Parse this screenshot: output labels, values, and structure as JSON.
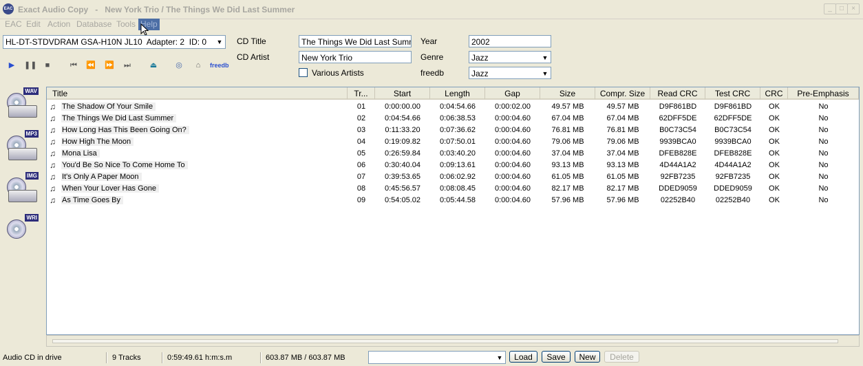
{
  "window": {
    "app_name": "Exact Audio Copy",
    "separator": "-",
    "document_title": "New York Trio / The Things We Did Last Summer",
    "app_icon_text": "EAC"
  },
  "menu": [
    "EAC",
    "Edit",
    "Action",
    "Database",
    "Tools",
    "Help"
  ],
  "drive": {
    "selected": "HL-DT-STDVDRAM GSA-H10N JL10  Adapter: 2  ID: 0"
  },
  "cd": {
    "title_label": "CD Title",
    "title_value": "The Things We Did Last Summer",
    "artist_label": "CD Artist",
    "artist_value": "New York Trio",
    "various_artists_label": "Various Artists",
    "various_artists_checked": false,
    "year_label": "Year",
    "year_value": "2002",
    "genre_label": "Genre",
    "genre_value": "Jazz",
    "freedb_label": "freedb",
    "freedb_value": "Jazz"
  },
  "toolbar": {
    "freedb_button": "freedb"
  },
  "side_buttons": [
    {
      "tag": "WAV",
      "name": "copy-wav-icon"
    },
    {
      "tag": "MP3",
      "name": "copy-mp3-icon"
    },
    {
      "tag": "IMG",
      "name": "copy-image-icon"
    },
    {
      "tag": "WRI",
      "name": "write-cd-icon"
    }
  ],
  "table": {
    "headers": [
      "Title",
      "Tr...",
      "Start",
      "Length",
      "Gap",
      "Size",
      "Compr. Size",
      "Read CRC",
      "Test CRC",
      "CRC",
      "Pre-Emphasis"
    ],
    "rows": [
      [
        "The Shadow Of Your Smile",
        "01",
        "0:00:00.00",
        "0:04:54.66",
        "0:00:02.00",
        "49.57 MB",
        "49.57 MB",
        "D9F861BD",
        "D9F861BD",
        "OK",
        "No"
      ],
      [
        "The Things We Did Last Summer",
        "02",
        "0:04:54.66",
        "0:06:38.53",
        "0:00:04.60",
        "67.04 MB",
        "67.04 MB",
        "62DFF5DE",
        "62DFF5DE",
        "OK",
        "No"
      ],
      [
        "How Long Has This Been Going On?",
        "03",
        "0:11:33.20",
        "0:07:36.62",
        "0:00:04.60",
        "76.81 MB",
        "76.81 MB",
        "B0C73C54",
        "B0C73C54",
        "OK",
        "No"
      ],
      [
        "How High The Moon",
        "04",
        "0:19:09.82",
        "0:07:50.01",
        "0:00:04.60",
        "79.06 MB",
        "79.06 MB",
        "9939BCA0",
        "9939BCA0",
        "OK",
        "No"
      ],
      [
        "Mona Lisa",
        "05",
        "0:26:59.84",
        "0:03:40.20",
        "0:00:04.60",
        "37.04 MB",
        "37.04 MB",
        "DFEB828E",
        "DFEB828E",
        "OK",
        "No"
      ],
      [
        "You'd Be So Nice To Come Home To",
        "06",
        "0:30:40.04",
        "0:09:13.61",
        "0:00:04.60",
        "93.13 MB",
        "93.13 MB",
        "4D44A1A2",
        "4D44A1A2",
        "OK",
        "No"
      ],
      [
        "It's Only A Paper Moon",
        "07",
        "0:39:53.65",
        "0:06:02.92",
        "0:00:04.60",
        "61.05 MB",
        "61.05 MB",
        "92FB7235",
        "92FB7235",
        "OK",
        "No"
      ],
      [
        "When Your Lover Has Gone",
        "08",
        "0:45:56.57",
        "0:08:08.45",
        "0:00:04.60",
        "82.17 MB",
        "82.17 MB",
        "DDED9059",
        "DDED9059",
        "OK",
        "No"
      ],
      [
        "As Time Goes By",
        "09",
        "0:54:05.02",
        "0:05:44.58",
        "0:00:04.60",
        "57.96 MB",
        "57.96 MB",
        "02252B40",
        "02252B40",
        "OK",
        "No"
      ]
    ]
  },
  "status": {
    "drive_state": "Audio CD in drive",
    "tracks": "9 Tracks",
    "duration": "0:59:49.61 h:m:s.m",
    "size": "603.87 MB / 603.87 MB",
    "load": "Load",
    "save": "Save",
    "new": "New",
    "delete": "Delete"
  }
}
